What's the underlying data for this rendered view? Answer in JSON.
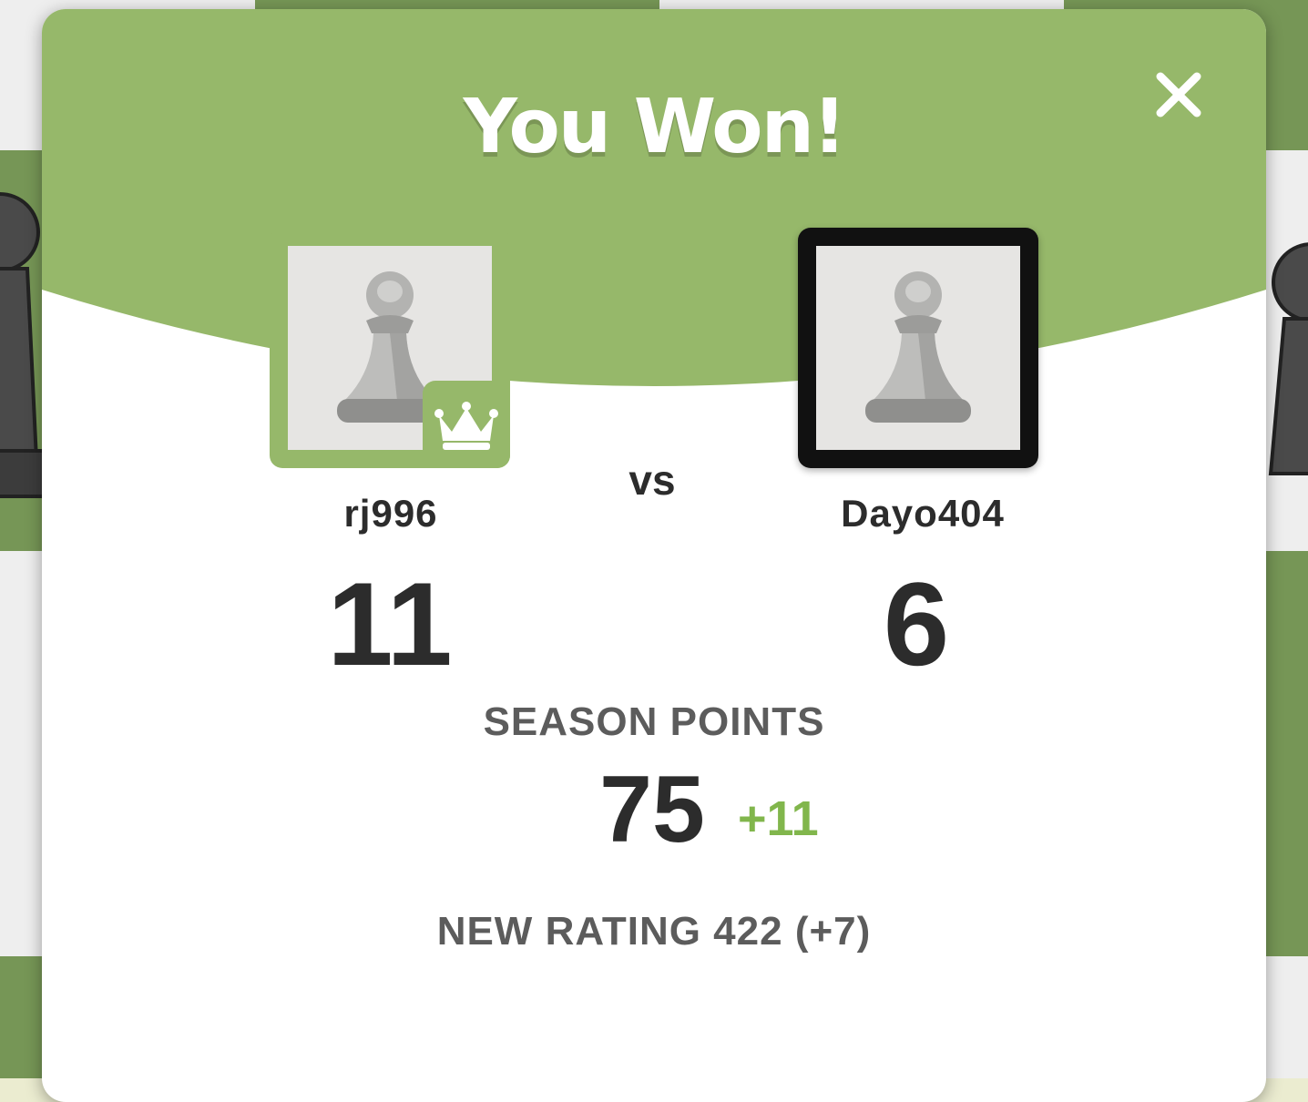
{
  "modal": {
    "title": "You Won!",
    "close_icon": "close-icon",
    "vs_label": "vs"
  },
  "players": {
    "left": {
      "username": "rj996",
      "score": "11",
      "avatar_icon": "pawn-icon",
      "badge_icon": "crown-icon",
      "is_winner": true
    },
    "right": {
      "username": "Dayo404",
      "score": "6",
      "avatar_icon": "pawn-icon",
      "is_winner": false
    }
  },
  "season": {
    "label": "SEASON POINTS",
    "value": "75",
    "delta": "+11"
  },
  "rating": {
    "text": "NEW RATING 422 (+7)"
  },
  "colors": {
    "header_green": "#96b86a",
    "delta_green": "#81b64c",
    "board_dark": "#769656",
    "board_light": "#eeeeee"
  }
}
